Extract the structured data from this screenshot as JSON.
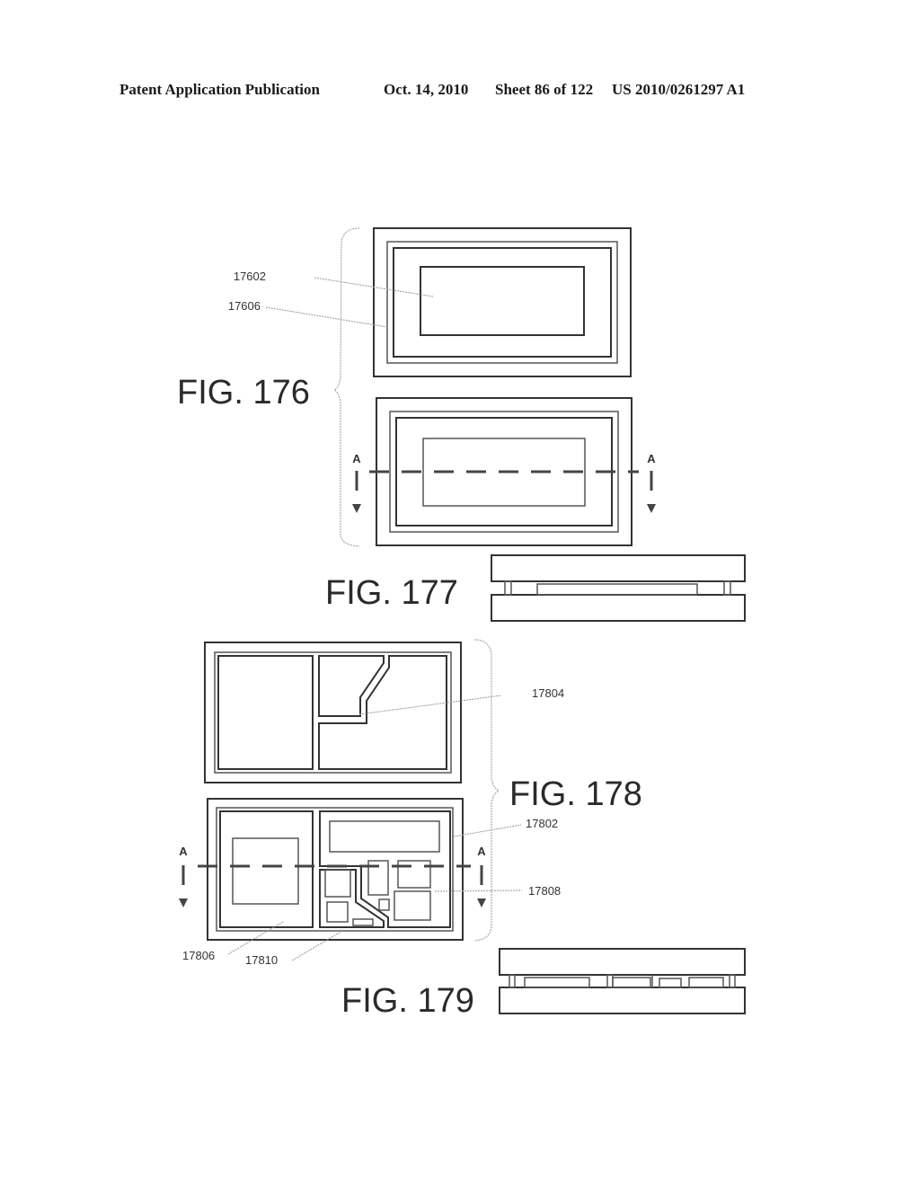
{
  "header": {
    "publication": "Patent Application Publication",
    "date": "Oct. 14, 2010",
    "sheet": "Sheet 86 of 122",
    "number": "US 2010/0261297 A1"
  },
  "figures": {
    "fig176": {
      "label": "FIG. 176",
      "refs": {
        "r17602": "17602",
        "r17606": "17606"
      }
    },
    "fig177": {
      "label": "FIG. 177"
    },
    "fig178": {
      "label": "FIG. 178",
      "refs": {
        "r17804": "17804",
        "r17802": "17802",
        "r17808": "17808",
        "r17806": "17806",
        "r17810": "17810"
      }
    },
    "fig179": {
      "label": "FIG. 179"
    }
  },
  "section_marker": "A"
}
